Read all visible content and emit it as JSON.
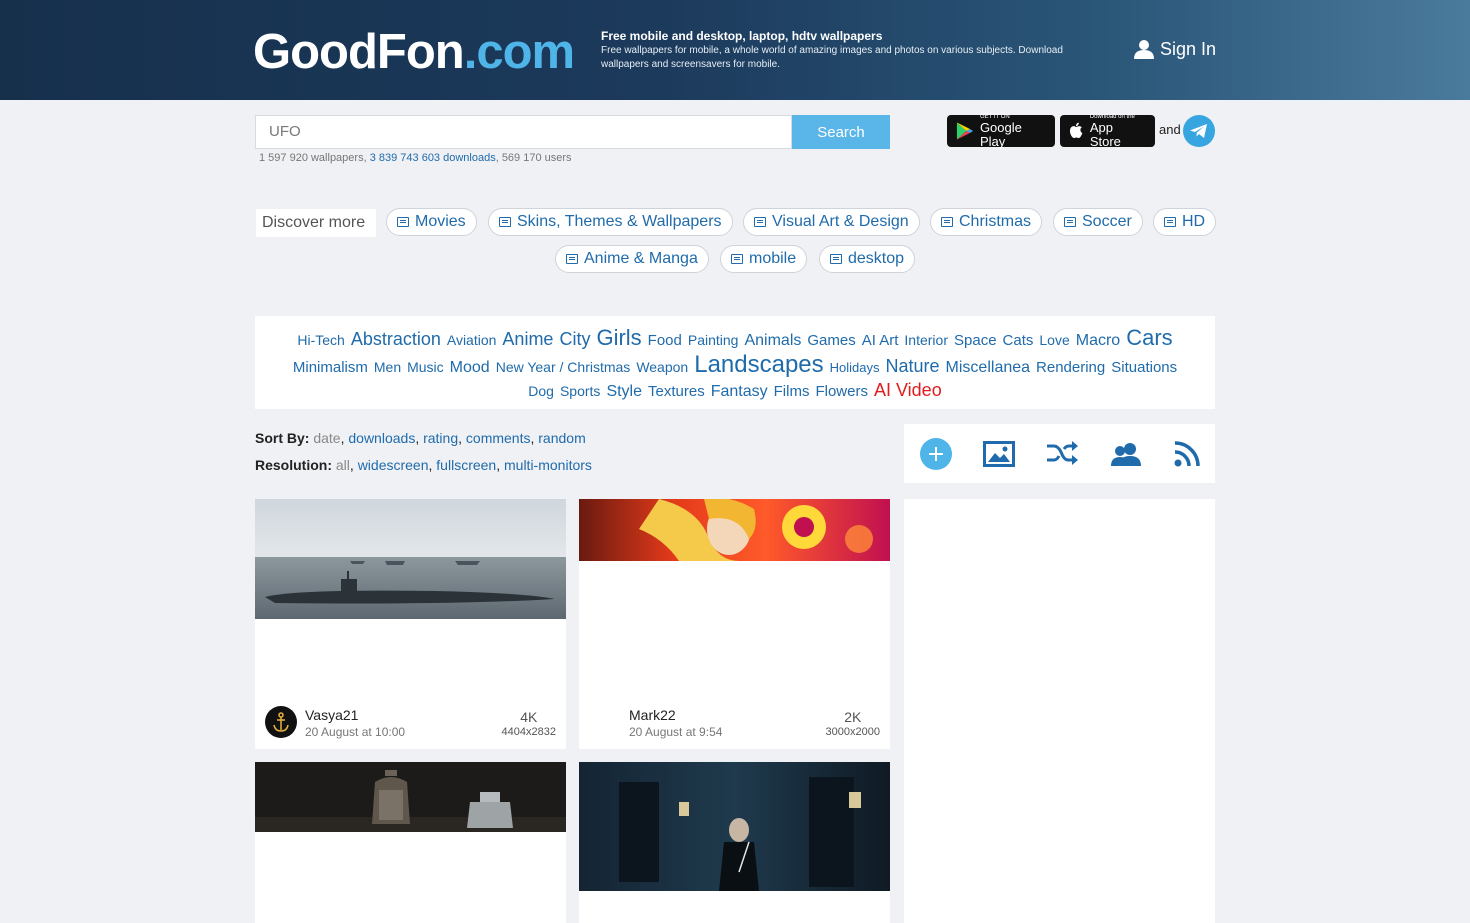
{
  "header": {
    "logo_part1": "GoodFon",
    "logo_part2": ".com",
    "tagline_title": "Free mobile and desktop, laptop, hdtv wallpapers",
    "tagline_text": "Free wallpapers for mobile, a whole world of amazing images and photos on various subjects. Download wallpapers and screensavers for mobile.",
    "signin_label": "Sign In"
  },
  "search": {
    "value": "UFO",
    "button_label": "Search"
  },
  "stats": {
    "wallpapers": "1 597 920 wallpapers,",
    "downloads": "3 839 743 603 downloads",
    "users": ", 569 170 users"
  },
  "apps": {
    "google_small": "GET IT ON",
    "google_big": "Google Play",
    "apple_small": "Download on the",
    "apple_big": "App Store",
    "and_label": "and"
  },
  "discover": {
    "label": "Discover more",
    "pills": [
      "Movies",
      "Skins, Themes & Wallpapers",
      "Visual Art & Design",
      "Christmas",
      "Soccer",
      "HD",
      "Anime & Manga",
      "mobile",
      "desktop"
    ]
  },
  "cloud": {
    "row1": [
      "Hi-Tech",
      "Abstraction",
      "Aviation",
      "Anime",
      "City",
      "Girls",
      "Food",
      "Painting",
      "Animals",
      "Games",
      "AI Art",
      "Interior",
      "Space",
      "Cats",
      "Love",
      "Macro",
      "Cars"
    ],
    "row2": [
      "Minimalism",
      "Men",
      "Music",
      "Mood",
      "New Year / Christmas",
      "Weapon",
      "Landscapes",
      "Holidays",
      "Nature",
      "Miscellanea",
      "Rendering",
      "Situations"
    ],
    "row3": [
      "Dog",
      "Sports",
      "Style",
      "Textures",
      "Fantasy",
      "Films",
      "Flowers",
      "AI Video"
    ]
  },
  "sort": {
    "label": "Sort By:",
    "options": [
      "date",
      "downloads",
      "rating",
      "comments",
      "random"
    ],
    "resolution_label": "Resolution:",
    "resolution_options": [
      "all",
      "widescreen",
      "fullscreen",
      "multi-monitors"
    ]
  },
  "toolbar": {
    "icons": [
      "plus-icon",
      "image-icon",
      "shuffle-icon",
      "users-icon",
      "rss-icon"
    ]
  },
  "cards": [
    {
      "author": "Vasya21",
      "date": "20 August at 10:00",
      "quality": "4K",
      "resolution": "4404x2832"
    },
    {
      "author": "Mark22",
      "date": "20 August at 9:54",
      "quality": "2K",
      "resolution": "3000x2000"
    }
  ],
  "colors": {
    "header_dark": "#16304c",
    "accent_blue": "#4fb4e8",
    "link_blue": "#1f6bab",
    "search_button": "#5ab5e8",
    "ai_video_red": "#e11c1c"
  }
}
